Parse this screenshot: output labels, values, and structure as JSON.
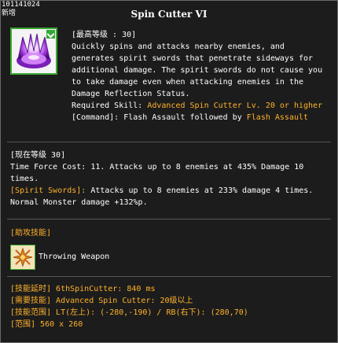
{
  "header": {
    "id_text": "101141024",
    "new_text": "新增",
    "title": "Spin Cutter VI"
  },
  "skill": {
    "icon": "spin-cutter-crystal-icon",
    "max_level_line": "[最高等级 : 30]",
    "description_lines": [
      "Quickly spins and attacks nearby enemies, and",
      "generates spirit swords that penetrate sideways for",
      "additional damage. The spirit swords do not cause you",
      "to take damage even when attacking enemies in the",
      "Damage Reflection Status."
    ],
    "required_label": "Required Skill: ",
    "required_value": "Advanced Spin Cutter Lv. 20 or higher",
    "command_label": "[Command]: Flash Assault followed by ",
    "command_value": "Flash Assault"
  },
  "current_level": {
    "header": "[现在等级 30]",
    "line1": "Time Force Cost: 11. Attacks up to 8 enemies at 435% Damage 10",
    "line2": "times.",
    "spirit_label": "[Spirit Swords]:",
    "spirit_text": " Attacks up to 8 enemies at 233% damage 4 times.",
    "line4": "Normal Monster damage +132%p."
  },
  "assist": {
    "header": "[助攻技能]",
    "icon": "throwing-weapon-icon",
    "label": "Throwing Weapon"
  },
  "info": {
    "delay": "[技能延时] 6thSpinCutter: 840 ms",
    "required": "[需要技能] Advanced Spin Cutter: 20级以上",
    "range": "[技能范围] LT(左上): (-280,-190) / RB(右下): (280,70)",
    "area": "[范围] 560 x 260"
  },
  "colors": {
    "background": "#1c1c1c",
    "text": "#ffffff",
    "highlight": "#ffb22c",
    "icon_border": "#3aa832"
  }
}
